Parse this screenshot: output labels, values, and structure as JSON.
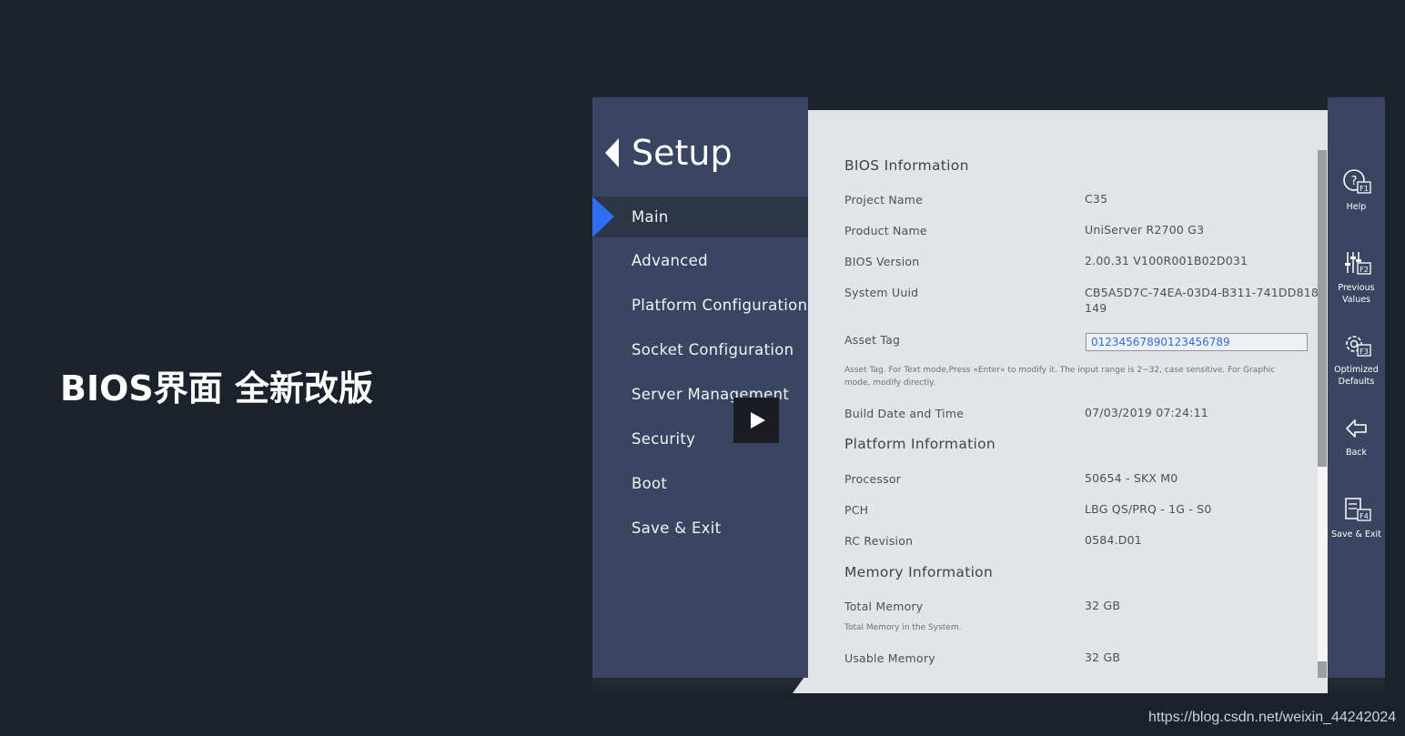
{
  "headline": "BIOS界面 全新改版",
  "watermark": "https://blog.csdn.net/weixin_44242024",
  "sidebar": {
    "title": "Setup",
    "items": [
      {
        "label": "Main",
        "active": true
      },
      {
        "label": "Advanced"
      },
      {
        "label": "Platform Configuration"
      },
      {
        "label": "Socket Configuration"
      },
      {
        "label": "Server Management"
      },
      {
        "label": "Security"
      },
      {
        "label": "Boot"
      },
      {
        "label": "Save & Exit"
      }
    ]
  },
  "content": {
    "bios_info": {
      "title": "BIOS Information",
      "project_name": {
        "label": "Project Name",
        "value": "C35"
      },
      "product_name": {
        "label": "Product Name",
        "value": "UniServer R2700 G3"
      },
      "bios_version": {
        "label": "BIOS Version",
        "value": "2.00.31 V100R001B02D031"
      },
      "system_uuid": {
        "label": "System Uuid",
        "value_line1": "CB5A5D7C-74EA-03D4-B311-741DD8186",
        "value_line2": "149"
      },
      "asset_tag": {
        "label": "Asset Tag",
        "value": "01234567890123456789"
      },
      "asset_tag_help_line1": "Asset Tag. For Text mode,Press «Enter» to modify it. The input range is 2~32, case sensitive. For Graphic",
      "asset_tag_help_line2": "mode, modify directly.",
      "build_date": {
        "label": "Build Date and Time",
        "value": "07/03/2019 07:24:11"
      }
    },
    "platform_info": {
      "title": "Platform Information",
      "processor": {
        "label": "Processor",
        "value": "50654 - SKX M0"
      },
      "pch": {
        "label": "PCH",
        "value": "LBG QS/PRQ - 1G - S0"
      },
      "rc_revision": {
        "label": "RC Revision",
        "value": "0584.D01"
      }
    },
    "memory_info": {
      "title": "Memory Information",
      "total_memory": {
        "label": "Total Memory",
        "value": "32 GB",
        "help": "Total Memory in the System."
      },
      "usable_memory": {
        "label": "Usable Memory",
        "value": "32 GB"
      }
    }
  },
  "function_keys": [
    {
      "label_line1": "Help",
      "label_line2": "",
      "key": "F1",
      "icon": "help-icon"
    },
    {
      "label_line1": "Previous",
      "label_line2": "Values",
      "key": "F2",
      "icon": "sliders-icon"
    },
    {
      "label_line1": "Optimized",
      "label_line2": "Defaults",
      "key": "F3",
      "icon": "gear-icon"
    },
    {
      "label_line1": "Back",
      "label_line2": "",
      "key": "",
      "icon": "back-arrow-icon"
    },
    {
      "label_line1": "Save & Exit",
      "label_line2": "",
      "key": "F4",
      "icon": "save-icon"
    }
  ],
  "colors": {
    "background": "#1c222c",
    "sidebar": "#3a4661",
    "active_marker": "#2d6ff0",
    "content_bg": "#e3e4e6",
    "asset_tag_text": "#2f6de0"
  }
}
